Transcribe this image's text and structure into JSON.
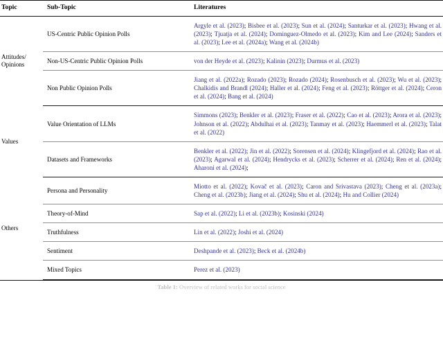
{
  "table": {
    "headers": {
      "topic": "Topic",
      "subtopic": "Sub-Topic",
      "literatures": "Literatures"
    },
    "accent_color": "#32329b",
    "sections": [
      {
        "topic": "Attitudes/ Opinions",
        "topic_line1": "Attitudes/",
        "topic_line2": "Opinions",
        "rows": [
          {
            "subtopic": "US-Centric Public Opinion Polls",
            "literatures": "Argyle et al. (2023); Bisbee et al. (2023); Sun et al. (2024); Santurkar et al. (2023); Hwang et al. (2023); Tjuatja et al. (2024); Dominguez-Olmedo et al. (2023); Kim and Lee (2024); Sanders et al. (2023); Lee et al. (2024a); Wang et al. (2024b)"
          },
          {
            "subtopic": "Non-US-Centric Public Opinion Polls",
            "literatures": "von der Heyde et al. (2023); Kalinin (2023); Durmus et al. (2023)"
          },
          {
            "subtopic": "Non Public Opinion Polls",
            "literatures": "Jiang et al. (2022a); Rozado (2023); Rozado (2024); Rosenbusch et al. (2023); Wu et al. (2023); Chalkidis and Brandl (2024); Haller et al. (2024); Feng et al. (2023); Röttger et al. (2024); Ceron et al. (2024); Bang et al. (2024)"
          }
        ]
      },
      {
        "topic": "Values",
        "topic_line1": "Values",
        "topic_line2": "",
        "rows": [
          {
            "subtopic": "Value Orientation of LLMs",
            "literatures": "Simmons (2023); Benkler et al. (2023); Fraser et al. (2022); Cao et al. (2023); Arora et al. (2023); Johnson et al. (2022); Abdulhai et al. (2023); Tanmay et al. (2023); Haemmerl et al. (2023); Talat et al. (2022)"
          },
          {
            "subtopic": "Datasets and Frameworks",
            "literatures": "Benkler et al. (2022); Jin et al. (2022); Sorensen et al. (2024); Klingefjord et al. (2024); Rao et al. (2023); Agarwal et al. (2024); Hendrycks et al. (2023); Scherrer et al. (2024); Ren et al. (2024); Aharoni et al. (2024);"
          }
        ]
      },
      {
        "topic": "Others",
        "topic_line1": "Others",
        "topic_line2": "",
        "rows": [
          {
            "subtopic": "Persona and Personality",
            "literatures": "Miotto et al. (2022); Kovač et al. (2023); Caron and Srivastava (2023); Cheng et al. (2023a); Cheng et al. (2023b); Jiang et al. (2024); Shu et al. (2024); Hu and Collier (2024)"
          },
          {
            "subtopic": "Theory-of-Mind",
            "literatures": "Sap et al. (2022); Li et al. (2023b); Kosinski (2024)"
          },
          {
            "subtopic": "Truthfulness",
            "literatures": "Lin et al. (2022); Joshi et al. (2024)"
          },
          {
            "subtopic": "Sentiment",
            "literatures": "Deshpande et al. (2023); Beck et al. (2024b)"
          },
          {
            "subtopic": "Mixed Topics",
            "literatures": "Perez et al. (2023)"
          }
        ]
      }
    ]
  },
  "caption": {
    "label": "Table 1:",
    "text": "Overview of related works for social science"
  }
}
